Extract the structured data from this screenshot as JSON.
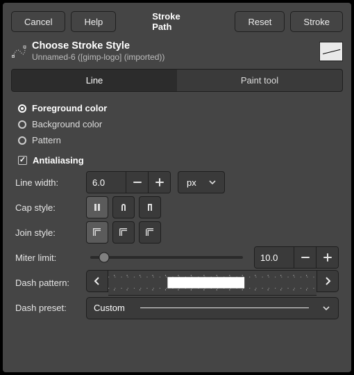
{
  "topbar": {
    "cancel": "Cancel",
    "help": "Help",
    "title": "Stroke Path",
    "reset": "Reset",
    "stroke": "Stroke"
  },
  "header": {
    "title": "Choose Stroke Style",
    "subtitle": "Unnamed-6 ([gimp-logo] (imported))"
  },
  "tabs": {
    "line": "Line",
    "paint": "Paint tool",
    "active": "line"
  },
  "style": {
    "fg": "Foreground color",
    "bg": "Background color",
    "pattern": "Pattern",
    "selected": "fg",
    "antialias_label": "Antialiasing",
    "antialias_checked": true
  },
  "line_width": {
    "label": "Line width:",
    "value": "6.0",
    "unit": "px"
  },
  "cap": {
    "label": "Cap style:",
    "selected": 0
  },
  "join": {
    "label": "Join style:",
    "selected": 0
  },
  "miter": {
    "label": "Miter limit:",
    "value": "10.0",
    "slider_pos_pct": 9
  },
  "dash": {
    "label": "Dash pattern:"
  },
  "preset": {
    "label": "Dash preset:",
    "value": "Custom"
  }
}
